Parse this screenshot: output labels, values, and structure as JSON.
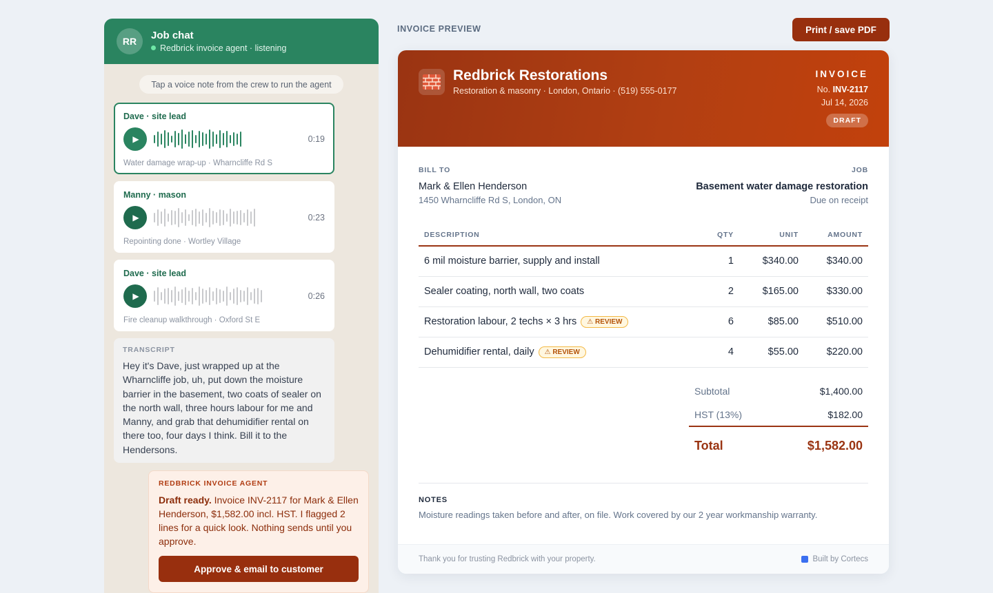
{
  "chat": {
    "avatar_initials": "RR",
    "title": "Job chat",
    "status": "Redbrick invoice agent · listening",
    "hint": "Tap a voice note from the crew to run the agent",
    "voice_notes": [
      {
        "sender": "Dave · site lead",
        "duration": "0:19",
        "caption": "Water damage wrap-up · Wharncliffe Rd S",
        "selected": true
      },
      {
        "sender": "Manny · mason",
        "duration": "0:23",
        "caption": "Repointing done · Wortley Village",
        "selected": false
      },
      {
        "sender": "Dave · site lead",
        "duration": "0:26",
        "caption": "Fire cleanup walkthrough · Oxford St E",
        "selected": false
      }
    ],
    "transcript": {
      "label": "TRANSCRIPT",
      "text": "Hey it's Dave, just wrapped up at the Wharncliffe job, uh, put down the moisture barrier in the basement, two coats of sealer on the north wall, three hours labour for me and Manny, and grab that dehumidifier rental on there too, four days I think. Bill it to the Hendersons."
    },
    "agent": {
      "label": "REDBRICK INVOICE AGENT",
      "lead": "Draft ready.",
      "text": " Invoice INV-2117 for Mark & Ellen Henderson, $1,582.00 incl. HST. I flagged 2 lines for a quick look. Nothing sends until you approve.",
      "approve_label": "Approve & email to customer"
    }
  },
  "preview": {
    "label": "INVOICE PREVIEW",
    "print_label": "Print / save PDF"
  },
  "invoice": {
    "company_name": "Redbrick Restorations",
    "company_sub": "Restoration & masonry · London, Ontario · (519) 555-0177",
    "word": "INVOICE",
    "no_prefix": "No.",
    "number": "INV-2117",
    "date": "Jul 14, 2026",
    "status": "DRAFT",
    "bill_to_label": "BILL TO",
    "bill_to_name": "Mark & Ellen Henderson",
    "bill_to_address": "1450 Wharncliffe Rd S, London, ON",
    "job_label": "JOB",
    "job_name": "Basement water damage restoration",
    "job_terms": "Due on receipt",
    "columns": {
      "description": "DESCRIPTION",
      "qty": "QTY",
      "unit": "UNIT",
      "amount": "AMOUNT"
    },
    "review_label": "⚠ REVIEW",
    "items": [
      {
        "description": "6 mil moisture barrier, supply and install",
        "qty": "1",
        "unit": "$340.00",
        "amount": "$340.00",
        "review": false
      },
      {
        "description": "Sealer coating, north wall, two coats",
        "qty": "2",
        "unit": "$165.00",
        "amount": "$330.00",
        "review": false
      },
      {
        "description": "Restoration labour, 2 techs × 3 hrs",
        "qty": "6",
        "unit": "$85.00",
        "amount": "$510.00",
        "review": true
      },
      {
        "description": "Dehumidifier rental, daily",
        "qty": "4",
        "unit": "$55.00",
        "amount": "$220.00",
        "review": true
      }
    ],
    "subtotal_label": "Subtotal",
    "subtotal": "$1,400.00",
    "tax_label": "HST (13%)",
    "tax": "$182.00",
    "total_label": "Total",
    "total": "$1,582.00",
    "notes_label": "NOTES",
    "notes": "Moisture readings taken before and after, on file. Work covered by our 2 year workmanship warranty.",
    "footer_thanks": "Thank you for trusting Redbrick with your property.",
    "footer_built": "Built by Cortecs"
  },
  "colors": {
    "chat_green": "#2a8460",
    "brand_brick": "#9a3412",
    "review_amber": "#b45309"
  }
}
